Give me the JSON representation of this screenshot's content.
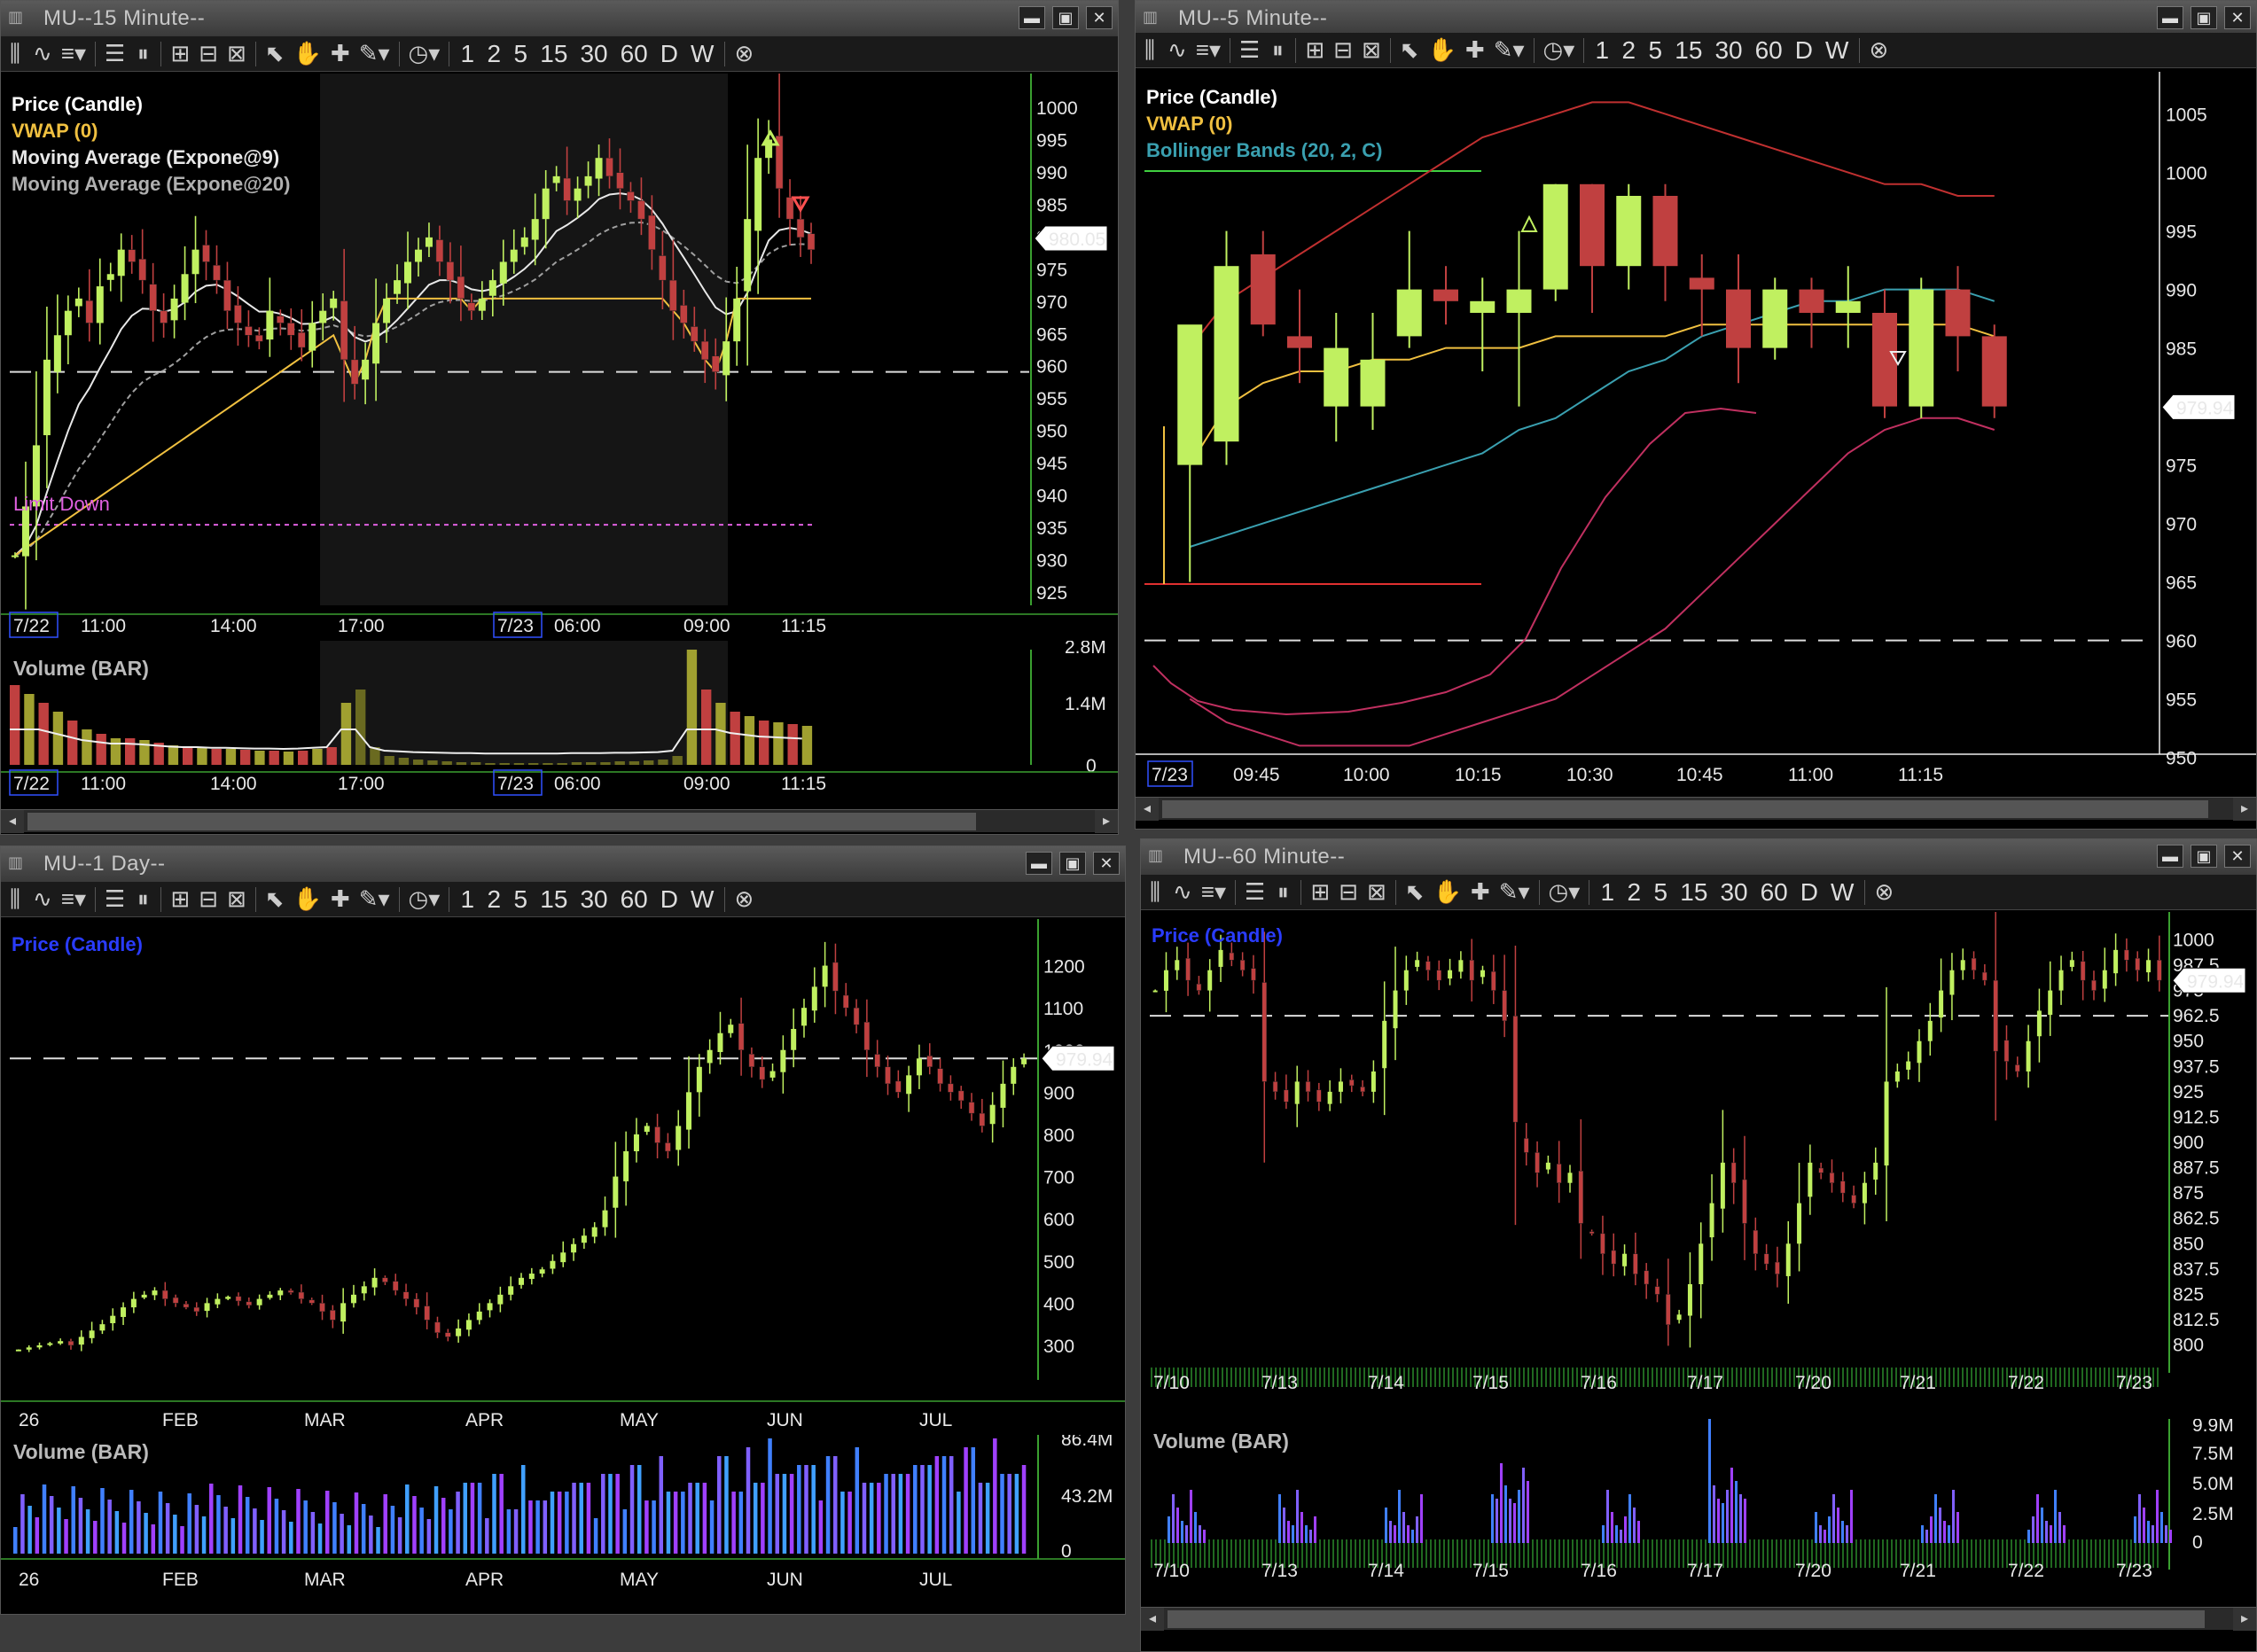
{
  "windows": {
    "w15": {
      "title": "MU--15 Minute--",
      "legend": [
        {
          "label": "Price (Candle)",
          "color": "#ffffff"
        },
        {
          "label": "VWAP (0)",
          "color": "#f0c040"
        },
        {
          "label": "Moving Average (Expone@9)",
          "color": "#e8e8e8"
        },
        {
          "label": "Moving Average (Expone@20)",
          "color": "#b0b0b0"
        }
      ],
      "annotation": "Limit Down",
      "price_tag": "980.05",
      "y_ticks": [
        "1000",
        "995",
        "990",
        "985",
        "980",
        "975",
        "970",
        "965",
        "960",
        "955",
        "950",
        "945",
        "940",
        "935",
        "930",
        "925"
      ],
      "x_ticks": [
        "7/22",
        "11:00",
        "14:00",
        "17:00",
        "7/23",
        "06:00",
        "09:00",
        "11:15"
      ],
      "volume_label": "Volume (BAR)",
      "volume_ticks": [
        "2.8M",
        "1.4M",
        "0"
      ]
    },
    "w5": {
      "title": "MU--5 Minute--",
      "legend": [
        {
          "label": "Price (Candle)",
          "color": "#ffffff"
        },
        {
          "label": "VWAP (0)",
          "color": "#f0c040"
        },
        {
          "label": "Bollinger Bands (20, 2, C)",
          "color": "#3aa0b0"
        }
      ],
      "price_tag": "979.94",
      "y_ticks": [
        "1005",
        "1000",
        "995",
        "990",
        "985",
        "980",
        "975",
        "970",
        "965",
        "960",
        "955",
        "950"
      ],
      "x_ticks": [
        "7/23",
        "09:45",
        "10:00",
        "10:15",
        "10:30",
        "10:45",
        "11:00",
        "11:15"
      ]
    },
    "w1d": {
      "title": "MU--1 Day--",
      "legend": [
        {
          "label": "Price (Candle)",
          "color": "#2a3cff"
        }
      ],
      "price_tag": "979.94",
      "y_ticks": [
        "1200",
        "1100",
        "1000",
        "900",
        "800",
        "700",
        "600",
        "500",
        "400",
        "300"
      ],
      "x_ticks": [
        "26",
        "FEB",
        "MAR",
        "APR",
        "MAY",
        "JUN",
        "JUL"
      ],
      "volume_label": "Volume (BAR)",
      "volume_ticks": [
        "86.4M",
        "43.2M",
        "0"
      ]
    },
    "w60": {
      "title": "MU--60 Minute--",
      "legend": [
        {
          "label": "Price (Candle)",
          "color": "#2a3cff"
        }
      ],
      "price_tag": "979.94",
      "y_ticks": [
        "1000",
        "987.5",
        "975",
        "962.5",
        "950",
        "937.5",
        "925",
        "912.5",
        "900",
        "887.5",
        "875",
        "862.5",
        "850",
        "837.5",
        "825",
        "812.5",
        "800"
      ],
      "x_ticks": [
        "7/10",
        "7/13",
        "7/14",
        "7/15",
        "7/16",
        "7/17",
        "7/20",
        "7/21",
        "7/22",
        "7/23"
      ],
      "volume_label": "Volume (BAR)",
      "volume_ticks": [
        "9.9M",
        "7.5M",
        "5.0M",
        "2.5M",
        "0"
      ]
    }
  },
  "toolbar": {
    "intervals": [
      "1",
      "2",
      "5",
      "15",
      "30",
      "60",
      "D",
      "W"
    ],
    "icons": [
      "chart-type-icon",
      "indicator-icon",
      "template-icon",
      "horizontal-lines-icon",
      "vertical-lines-icon",
      "zoom-in-icon",
      "zoom-out-icon",
      "zoom-fit-icon",
      "pointer-icon",
      "pan-hand-icon",
      "crosshair-icon",
      "draw-pen-icon",
      "clock-icon",
      "clear-icon"
    ]
  },
  "colors": {
    "up": "#c0f060",
    "down": "#c04040",
    "vwap": "#f0c040",
    "bollinger": "#3aa0b0",
    "band": "#c03030"
  },
  "chart_data": [
    {
      "id": "15min",
      "type": "candlestick",
      "title": "MU--15 Minute--",
      "ylim": [
        924,
        1003
      ],
      "reference_line": 960,
      "limit_down": 935,
      "closes": [
        930,
        938,
        948,
        962,
        966,
        970,
        972,
        968,
        974,
        976,
        980,
        978,
        975,
        970,
        968,
        972,
        976,
        980,
        978,
        975,
        970,
        968,
        966,
        965,
        970,
        968,
        966,
        964,
        968,
        970,
        972,
        962,
        958,
        962,
        968,
        972,
        975,
        978,
        980,
        982,
        978,
        975,
        972,
        970,
        972,
        975,
        978,
        980,
        982,
        985,
        990,
        992,
        988,
        990,
        992,
        995,
        992,
        990,
        988,
        985,
        980,
        975,
        970,
        968,
        965,
        962,
        960,
        965,
        972,
        985,
        995,
        998,
        990,
        985,
        982,
        980
      ]
    },
    {
      "id": "5min",
      "type": "candlestick",
      "title": "MU--5 Minute--",
      "ylim": [
        948,
        1008
      ],
      "reference_line": 960,
      "candles": [
        [
          975,
          987,
          965,
          975
        ],
        [
          977,
          992,
          975,
          995
        ],
        [
          993,
          987,
          986,
          995
        ],
        [
          986,
          985,
          982,
          990
        ],
        [
          980,
          985,
          977,
          988
        ],
        [
          980,
          984,
          978,
          988
        ],
        [
          986,
          990,
          985,
          995
        ],
        [
          990,
          989,
          987,
          992
        ],
        [
          988,
          989,
          983,
          991
        ],
        [
          988,
          990,
          980,
          995
        ],
        [
          990,
          999,
          989,
          999
        ],
        [
          999,
          992,
          988,
          999
        ],
        [
          992,
          998,
          990,
          999
        ],
        [
          998,
          992,
          989,
          999
        ],
        [
          991,
          990,
          986,
          993
        ],
        [
          990,
          985,
          982,
          993
        ],
        [
          985,
          990,
          984,
          991
        ],
        [
          990,
          988,
          985,
          991
        ],
        [
          988,
          989,
          985,
          992
        ],
        [
          988,
          980,
          979,
          990
        ],
        [
          980,
          990,
          979,
          991
        ],
        [
          990,
          986,
          983,
          992
        ],
        [
          986,
          980,
          979,
          987
        ]
      ],
      "vwap": [
        975,
        980,
        982,
        983,
        983,
        984,
        984,
        985,
        985,
        985,
        986,
        986,
        986,
        986,
        987,
        987,
        987,
        987,
        987,
        987,
        987,
        987,
        986
      ],
      "bb_mid": [
        968,
        969,
        970,
        971,
        972,
        973,
        974,
        975,
        976,
        978,
        979,
        981,
        983,
        984,
        986,
        987,
        988,
        989,
        989,
        990,
        990,
        990,
        989
      ],
      "bb_upper": [
        985,
        989,
        991,
        993,
        995,
        997,
        999,
        1001,
        1003,
        1004,
        1005,
        1006,
        1006,
        1005,
        1004,
        1003,
        1002,
        1001,
        1000,
        999,
        999,
        998,
        998
      ],
      "bb_lower": [
        955,
        953,
        952,
        951,
        951,
        951,
        951,
        952,
        953,
        954,
        955,
        957,
        959,
        961,
        964,
        967,
        970,
        973,
        976,
        978,
        979,
        979,
        978
      ]
    },
    {
      "id": "1day",
      "type": "candlestick",
      "title": "MU--1 Day--",
      "ylim": [
        260,
        1260
      ],
      "reference_line": 979.94,
      "closes": [
        290,
        295,
        300,
        305,
        310,
        300,
        320,
        335,
        350,
        370,
        390,
        410,
        420,
        430,
        410,
        400,
        390,
        380,
        400,
        410,
        415,
        405,
        395,
        410,
        420,
        430,
        425,
        410,
        400,
        380,
        360,
        400,
        420,
        440,
        460,
        450,
        430,
        410,
        390,
        360,
        330,
        320,
        340,
        360,
        380,
        400,
        420,
        440,
        460,
        470,
        480,
        500,
        520,
        540,
        560,
        580,
        620,
        700,
        760,
        800,
        820,
        780,
        760,
        820,
        900,
        960,
        1000,
        1040,
        1060,
        1000,
        960,
        930,
        950,
        1000,
        1050,
        1100,
        1150,
        1200,
        1140,
        1100,
        1060,
        1000,
        960,
        920,
        900,
        940,
        980,
        960,
        920,
        900,
        880,
        850,
        820,
        870,
        920,
        960,
        980
      ]
    },
    {
      "id": "60min",
      "type": "candlestick",
      "title": "MU--60 Minute--",
      "ylim": [
        795,
        1005
      ],
      "reference_line": 962.5,
      "closes": [
        975,
        985,
        990,
        980,
        975,
        985,
        995,
        990,
        985,
        980,
        930,
        925,
        920,
        930,
        925,
        920,
        925,
        930,
        928,
        925,
        935,
        960,
        975,
        985,
        990,
        985,
        980,
        985,
        990,
        980,
        985,
        975,
        960,
        910,
        895,
        885,
        890,
        880,
        885,
        860,
        855,
        845,
        840,
        845,
        835,
        830,
        825,
        810,
        815,
        830,
        850,
        870,
        890,
        880,
        860,
        845,
        840,
        835,
        850,
        870,
        890,
        885,
        880,
        875,
        870,
        880,
        890,
        930,
        935,
        940,
        950,
        960,
        975,
        985,
        990,
        985,
        980,
        945,
        940,
        935,
        950,
        965,
        975,
        985,
        990,
        980,
        975,
        985,
        995,
        990,
        985,
        990,
        980
      ]
    }
  ]
}
